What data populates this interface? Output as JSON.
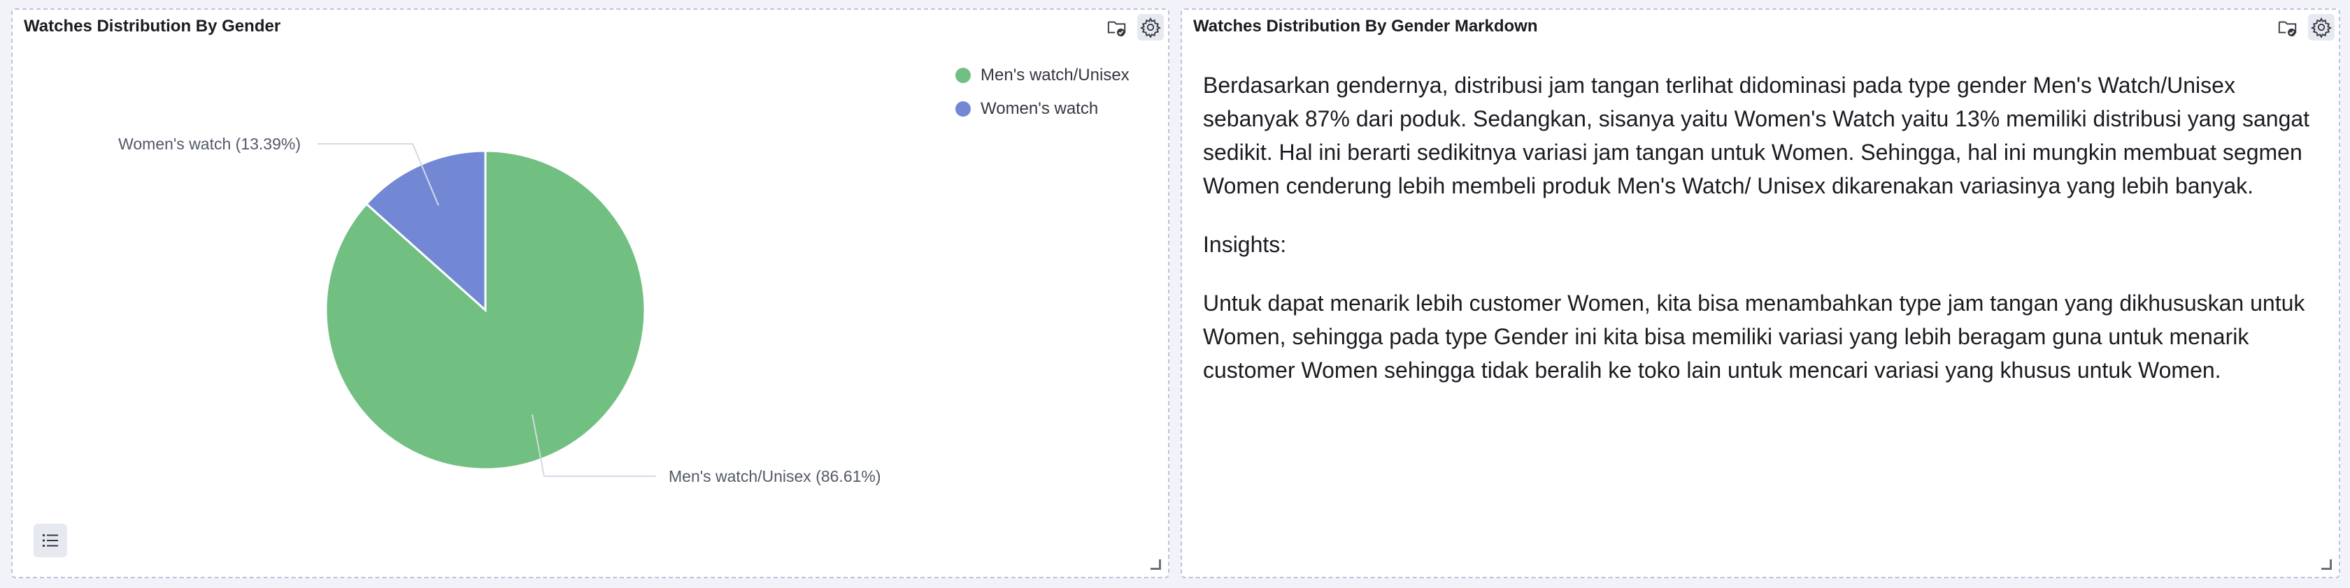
{
  "left_panel": {
    "title": "Watches Distribution By Gender",
    "icons": [
      "folder-check-icon",
      "gear-icon"
    ],
    "legend_toggle_icon": "list-icon"
  },
  "right_panel": {
    "title": "Watches Distribution By Gender Markdown",
    "icons": [
      "folder-check-icon",
      "gear-icon"
    ],
    "paragraphs": [
      "Berdasarkan gendernya, distribusi jam tangan terlihat didominasi pada type gender Men's Watch/Unisex sebanyak 87% dari poduk. Sedangkan, sisanya yaitu Women's Watch yaitu 13% memiliki distribusi yang sangat sedikit. Hal ini berarti sedikitnya variasi jam tangan untuk Women. Sehingga, hal ini mungkin membuat segmen Women cenderung lebih membeli produk Men's Watch/ Unisex dikarenakan variasinya yang lebih banyak.",
      "Insights:",
      "Untuk dapat menarik lebih customer Women, kita bisa menambahkan type jam tangan yang dikhususkan untuk Women, sehingga pada type Gender ini kita bisa memiliki variasi yang lebih beragam guna untuk menarik customer Women sehingga tidak beralih ke toko lain untuk mencari variasi yang khusus untuk Women."
    ]
  },
  "chart_data": {
    "type": "pie",
    "title": "Watches Distribution By Gender",
    "slices": [
      {
        "name": "Men's watch/Unisex",
        "value": 86.61,
        "label": "Men's watch/Unisex (86.61%)",
        "color": "#72bf82"
      },
      {
        "name": "Women's watch",
        "value": 13.39,
        "label": "Women's watch (13.39%)",
        "color": "#7388d5"
      }
    ],
    "legend": {
      "position": "top-right",
      "entries": [
        "Men's watch/Unisex",
        "Women's watch"
      ]
    }
  },
  "colors": {
    "panel_border": "#c2bfe0",
    "men_slice": "#72bf82",
    "women_slice": "#7388d5"
  }
}
